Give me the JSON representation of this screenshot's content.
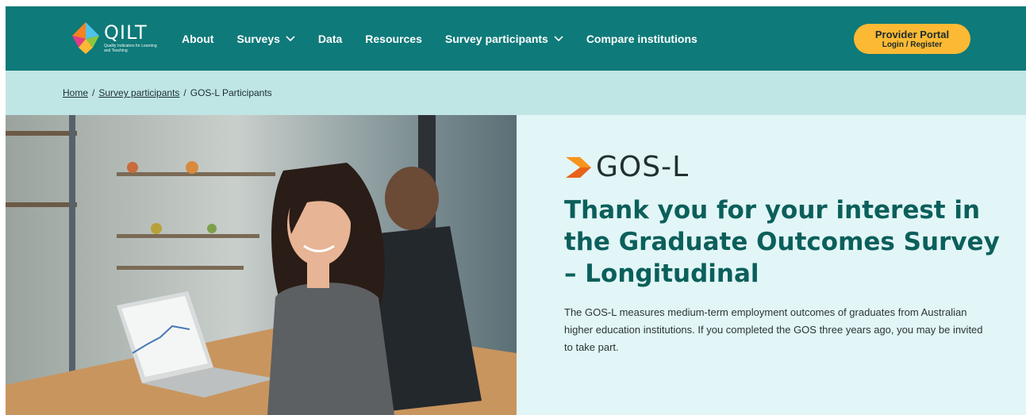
{
  "header": {
    "logo": {
      "name": "QILT",
      "tagline": "Quality Indicators for Learning and Teaching"
    },
    "nav": [
      {
        "label": "About",
        "has_dropdown": false
      },
      {
        "label": "Surveys",
        "has_dropdown": true
      },
      {
        "label": "Data",
        "has_dropdown": false
      },
      {
        "label": "Resources",
        "has_dropdown": false
      },
      {
        "label": "Survey participants",
        "has_dropdown": true
      },
      {
        "label": "Compare institutions",
        "has_dropdown": false
      }
    ],
    "portal": {
      "title": "Provider Portal",
      "subtitle": "Login / Register"
    }
  },
  "breadcrumb": {
    "home": "Home",
    "separator": "/",
    "parent": "Survey participants",
    "current": "GOS-L Participants"
  },
  "hero": {
    "brand_name": "GOS-L",
    "title": "Thank you for your interest in the Graduate Outcomes Survey – Longitudinal",
    "description": "The GOS-L measures medium-term employment outcomes of graduates from Australian higher education institutions. If you completed the GOS three years ago, you may be invited to take part."
  },
  "colors": {
    "header_bg": "#0e7a79",
    "breadcrumb_bg": "#bfe6e5",
    "panel_bg": "#e2f6f7",
    "accent_yellow": "#fbb934",
    "title_teal": "#0b5f5b",
    "brand_orange": "#f58220"
  },
  "icons": {
    "dropdown": "chevron-down-icon",
    "logo": "qilt-logo-icon",
    "brand": "gos-l-chevron-icon"
  }
}
